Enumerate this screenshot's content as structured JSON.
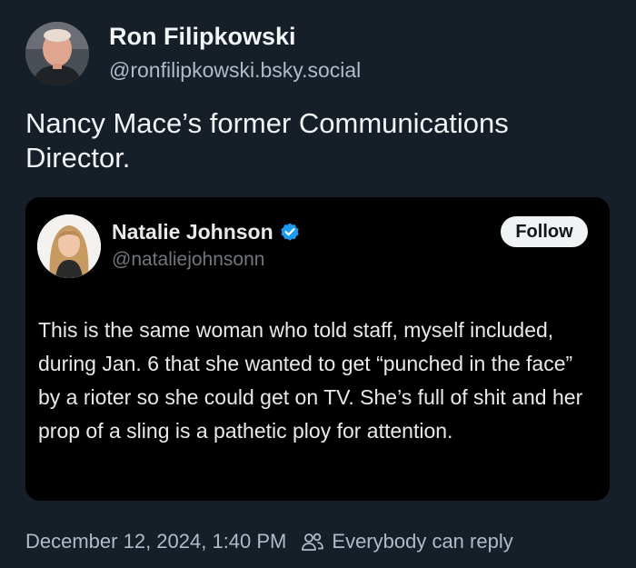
{
  "post": {
    "author": {
      "name": "Ron Filipkowski",
      "handle": "@ronfilipkowski.bsky.social",
      "avatar_icon": "person-avatar"
    },
    "text": "Nancy Mace’s former Communications Director.",
    "timestamp": "December 12, 2024, 1:40 PM",
    "reply_setting": "Everybody can reply",
    "reply_icon": "people-icon"
  },
  "quote": {
    "author": {
      "name": "Natalie Johnson",
      "handle": "@nataliejohnsonn",
      "verified": true,
      "avatar_icon": "person-avatar"
    },
    "follow_label": "Follow",
    "text": "This is the same woman who told staff, myself included, during Jan. 6 that she wanted to get “punched in the face” by a rioter so she could get on TV. She’s full of shit and her prop of a sling is a pathetic ploy for attention."
  },
  "colors": {
    "background": "#161e27",
    "card_background": "#000000",
    "verified_blue": "#1d9bf0",
    "muted_text": "#aebbc9"
  }
}
